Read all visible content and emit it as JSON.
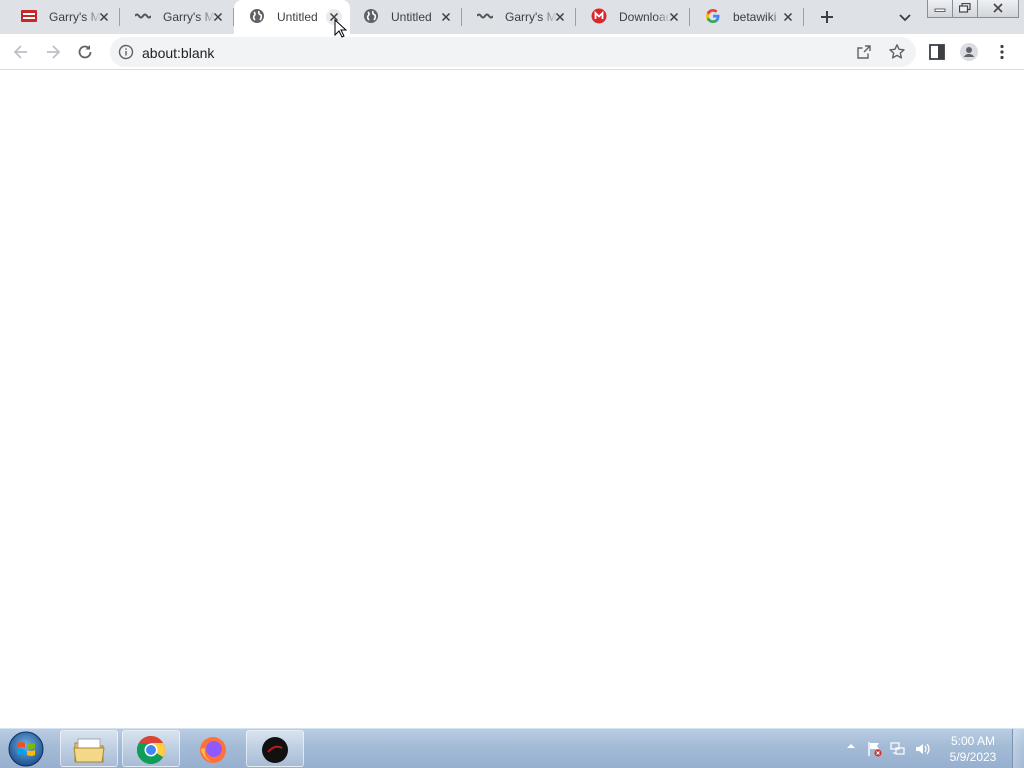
{
  "browser": {
    "tabs": [
      {
        "title": "Garry's Mod",
        "favicon": "gmod-icon",
        "active": false
      },
      {
        "title": "Garry's Mod",
        "favicon": "gmod-wave-icon",
        "active": false
      },
      {
        "title": "Untitled",
        "favicon": "globe-icon",
        "active": true
      },
      {
        "title": "Untitled",
        "favicon": "globe-icon",
        "active": false
      },
      {
        "title": "Garry's Mod",
        "favicon": "gmod-wave-icon",
        "active": false
      },
      {
        "title": "Download",
        "favicon": "mega-icon",
        "active": false
      },
      {
        "title": "betawiki",
        "favicon": "google-icon",
        "active": false
      }
    ],
    "address": {
      "url": "about:blank"
    }
  },
  "taskbar": {
    "apps": [
      {
        "name": "file-explorer",
        "icon": "folder-icon"
      },
      {
        "name": "chrome",
        "icon": "chrome-icon",
        "active": true
      },
      {
        "name": "firefox",
        "icon": "firefox-icon"
      },
      {
        "name": "app",
        "icon": "dark-app-icon"
      }
    ],
    "clock": {
      "time": "5:00 AM",
      "date": "5/9/2023"
    }
  },
  "colors": {
    "tab_strip": "#dee1e6",
    "omnibox": "#f1f3f4",
    "taskbar": "#a4bbd6"
  }
}
